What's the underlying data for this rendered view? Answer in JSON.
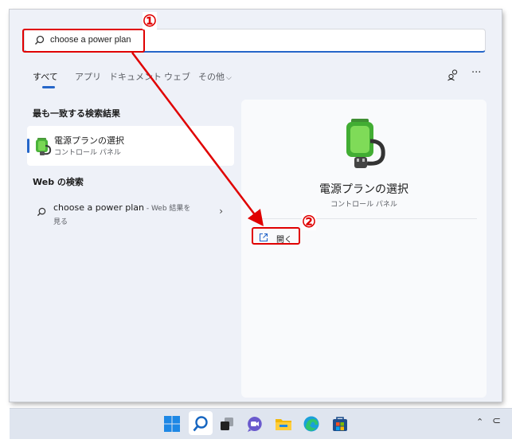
{
  "search": {
    "query": "choose a power plan"
  },
  "tabs": [
    {
      "label": "すべて"
    },
    {
      "label": "アプリ"
    },
    {
      "label": "ドキュメント"
    },
    {
      "label": "ウェブ"
    },
    {
      "label": "その他"
    }
  ],
  "best_match": {
    "heading": "最も一致する検索結果",
    "title": "電源プランの選択",
    "subtitle": "コントロール パネル"
  },
  "web_search": {
    "heading": "Web の検索",
    "query": "choose a power plan",
    "suffix": " - Web 結果を見る"
  },
  "detail": {
    "title": "電源プランの選択",
    "subtitle": "コントロール パネル",
    "open_label": "開く"
  },
  "annotations": {
    "one": "①",
    "two": "②"
  },
  "colors": {
    "annotation": "#e00000",
    "accent": "#2566c9"
  },
  "taskbar_icons": [
    "windows-start-icon",
    "search-icon",
    "task-view-icon",
    "teams-chat-icon",
    "file-explorer-icon",
    "edge-icon",
    "store-icon"
  ]
}
